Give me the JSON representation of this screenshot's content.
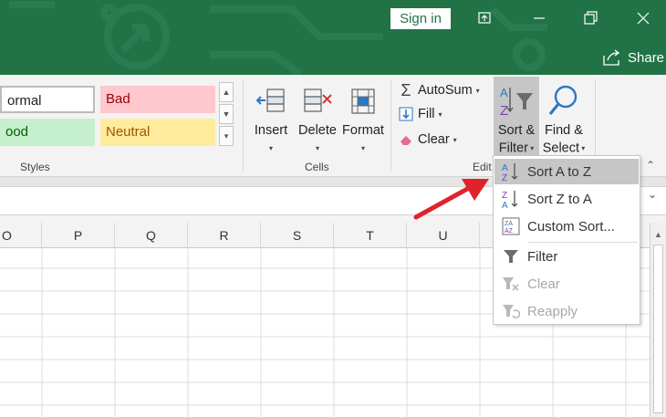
{
  "titlebar": {
    "signin_label": "Sign in",
    "share_label": "Share",
    "window_buttons": [
      "ribbon-display-icon",
      "minimize-icon",
      "restore-icon",
      "close-icon"
    ]
  },
  "styles": {
    "cells": [
      {
        "label": "ormal",
        "bg": "#ffffff",
        "fg": "#222222"
      },
      {
        "label": "Bad",
        "bg": "#ffc7ce",
        "fg": "#9c0006"
      },
      {
        "label": "ood",
        "bg": "#c6efce",
        "fg": "#006100"
      },
      {
        "label": "Neutral",
        "bg": "#ffeb9c",
        "fg": "#9c5700"
      }
    ],
    "group_label": "Styles"
  },
  "cells_group": {
    "insert_label": "Insert",
    "delete_label": "Delete",
    "format_label": "Format",
    "group_label": "Cells"
  },
  "editing": {
    "autosum_label": "AutoSum",
    "fill_label": "Fill",
    "clear_label": "Clear",
    "sort_line1": "Sort &",
    "sort_line2": "Filter",
    "find_line1": "Find &",
    "find_line2": "Select",
    "group_label": "Edit"
  },
  "columns": [
    "O",
    "P",
    "Q",
    "R",
    "S",
    "T",
    "U"
  ],
  "sort_menu": {
    "items": [
      {
        "label": "Sort A to Z",
        "icon": "sort-a-to-z-icon",
        "state": "highlighted"
      },
      {
        "label": "Sort Z to A",
        "icon": "sort-z-to-a-icon",
        "state": "enabled"
      },
      {
        "label": "Custom Sort...",
        "icon": "custom-sort-icon",
        "state": "enabled"
      },
      {
        "label": "Filter",
        "icon": "filter-icon",
        "state": "enabled"
      },
      {
        "label": "Clear",
        "icon": "clear-filter-icon",
        "state": "disabled"
      },
      {
        "label": "Reapply",
        "icon": "reapply-icon",
        "state": "disabled"
      }
    ]
  },
  "colors": {
    "title_green": "#217346",
    "ribbon_bg": "#f3f3f3",
    "arrow_red": "#e0232b",
    "highlight": "#c6c6c6"
  }
}
